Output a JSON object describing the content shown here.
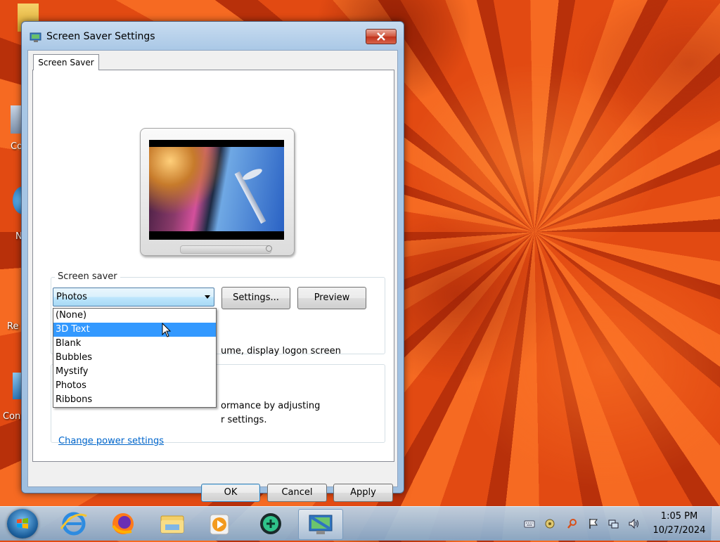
{
  "window": {
    "title": "Screen Saver Settings",
    "tab_label": "Screen Saver"
  },
  "screen_saver_group": {
    "label": "Screen saver",
    "selected": "Photos",
    "settings_button": "Settings...",
    "preview_button": "Preview",
    "resume_text_visible": "ume, display logon screen"
  },
  "dropdown": {
    "options": [
      "(None)",
      "3D Text",
      "Blank",
      "Bubbles",
      "Mystify",
      "Photos",
      "Ribbons"
    ],
    "highlighted": "3D Text"
  },
  "power_group": {
    "text_line1": "ormance by adjusting",
    "text_line2": "r settings.",
    "link": "Change power settings"
  },
  "buttons": {
    "ok": "OK",
    "cancel": "Cancel",
    "apply": "Apply"
  },
  "desktop_labels": [
    "Co",
    "N",
    "Re",
    "Con"
  ],
  "taskbar": {
    "items": [
      "internet-explorer-icon",
      "firefox-icon",
      "file-explorer-icon",
      "media-player-icon",
      "app-icon",
      "screen-saver-settings-icon"
    ],
    "clock_time": "1:05 PM",
    "clock_date": "10/27/2024"
  },
  "colors": {
    "selection": "#3399ff",
    "link": "#0066cc",
    "close_button": "#c0321c"
  }
}
